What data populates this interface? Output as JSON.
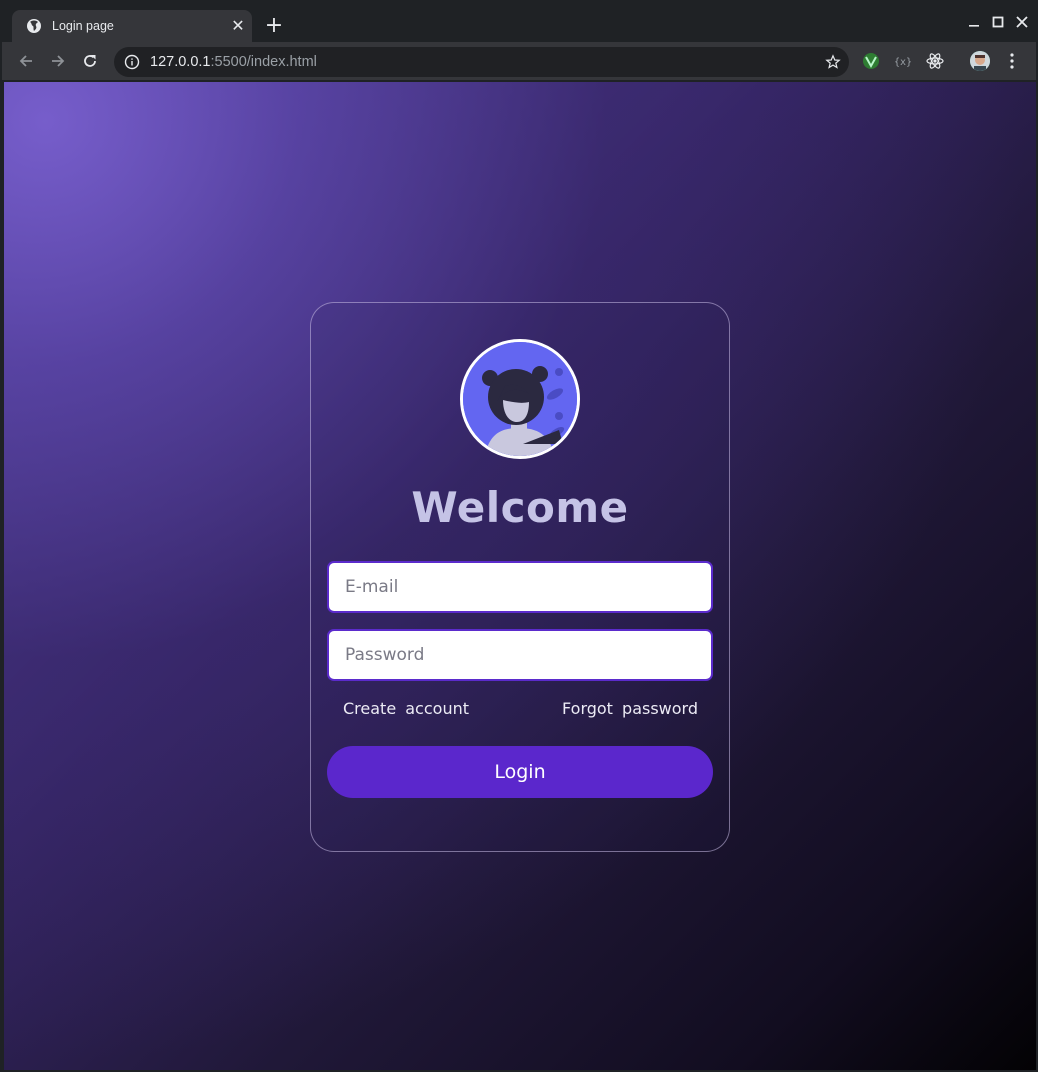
{
  "browser": {
    "tab": {
      "title": "Login page",
      "close": "✕"
    },
    "new_tab": "+",
    "url": {
      "host": "127.0.0.1",
      "rest": ":5500/index.html"
    }
  },
  "page": {
    "heading": "Welcome",
    "email_placeholder": "E-mail",
    "password_placeholder": "Password",
    "create_account": "Create account",
    "forgot_password": "Forgot password",
    "login_button": "Login"
  },
  "colors": {
    "accent": "#5b27cc",
    "avatar_bg": "#6366f1",
    "heading": "#c5c3e6"
  },
  "icons": {
    "tab": "globe-icon",
    "back": "back-arrow-icon",
    "forward": "forward-arrow-icon",
    "reload": "reload-icon",
    "site_info": "info-icon",
    "bookmark": "star-icon",
    "menu": "kebab-menu-icon"
  }
}
